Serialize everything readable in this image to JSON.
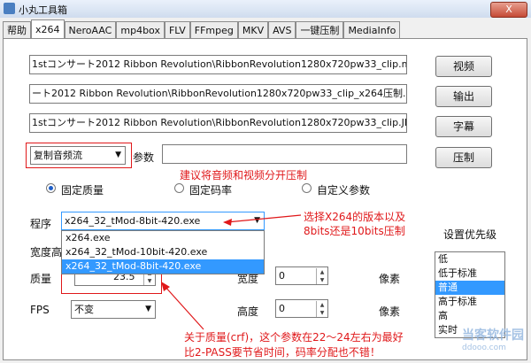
{
  "window": {
    "title": "小丸工具箱",
    "close_label": "X"
  },
  "tabs": [
    "帮助",
    "x264",
    "NeroAAC",
    "mp4box",
    "FLV",
    "FFmpeg",
    "MKV",
    "AVS",
    "一键压制",
    "MediaInfo"
  ],
  "files": {
    "video": "1stコンサート2012 Ribbon Revolution\\RibbonRevolution1280x720pw33_clip.mp4",
    "output": "ート2012 Ribbon Revolution\\RibbonRevolution1280x720pw33_clip_x264压制.mp4",
    "subtitle": "1stコンサート2012 Ribbon Revolution\\RibbonRevolution1280x720pw33_clip.JP.ass"
  },
  "buttons": {
    "video": "视频",
    "output": "输出",
    "subtitle": "字幕",
    "encode": "压制"
  },
  "audio_mode": {
    "value": "复制音频流"
  },
  "params": {
    "label": "参数",
    "value": ""
  },
  "modes": [
    "固定质量",
    "固定码率",
    "自定义参数"
  ],
  "program": {
    "label": "程序",
    "value": "x264_32_tMod-8bit-420.exe",
    "options": [
      "x264.exe",
      "x264_32_tMod-10bit-420.exe",
      "x264_32_tMod-8bit-420.exe"
    ]
  },
  "resolution_label": "宽度高",
  "quality": {
    "label": "质量",
    "value": "23.5"
  },
  "width": {
    "label": "宽度",
    "value": "0",
    "unit": "像素"
  },
  "height": {
    "label": "高度",
    "value": "0",
    "unit": "像素"
  },
  "fps": {
    "label": "FPS",
    "value": "不变"
  },
  "priority": {
    "label": "设置优先级",
    "options": [
      "低",
      "低于标准",
      "普通",
      "高于标准",
      "高",
      "实时"
    ],
    "selected": 2
  },
  "annotations": {
    "audio": "建议将音频和视频分开压制",
    "program_line1": "选择X264的版本以及",
    "program_line2": "8bits还是10bits压制",
    "quality_line1": "关于质量(crf)，这个参数在22～24左右为最好",
    "quality_line2": "比2-PASS要节省时间，码率分配也不错！"
  },
  "watermark": {
    "name": "当客软件园",
    "url": "ddooo.com"
  },
  "colors": {
    "annotation": "#e0181a",
    "selection": "#3399ff"
  }
}
